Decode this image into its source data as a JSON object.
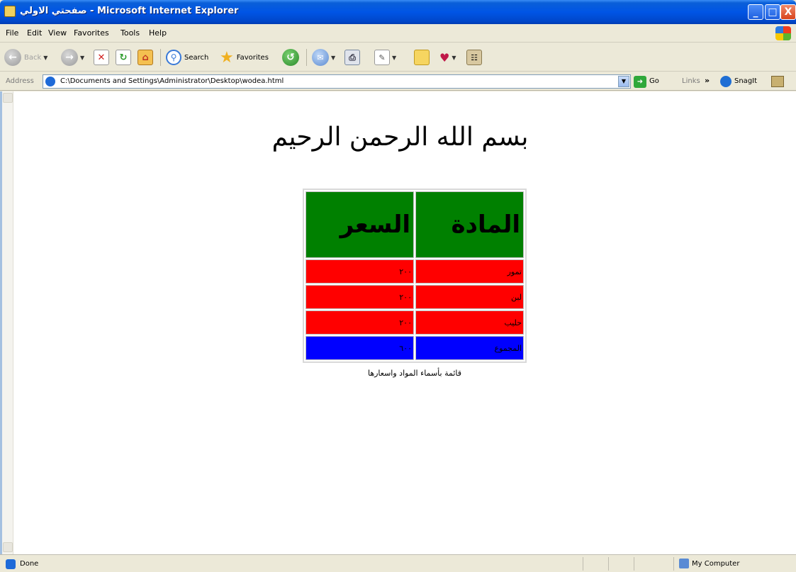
{
  "window": {
    "title": "صفحتي الاولي - Microsoft Internet Explorer",
    "minimize_glyph": "_",
    "maximize_glyph": "□",
    "close_glyph": "X"
  },
  "menu": [
    "File",
    "Edit",
    "View",
    "Favorites",
    "Tools",
    "Help"
  ],
  "toolbar": {
    "back": "Back",
    "search": "Search",
    "favorites": "Favorites"
  },
  "address_bar": {
    "label": "Address",
    "value": "C:\\Documents and Settings\\Administrator\\Desktop\\wodea.html",
    "go_label": "Go",
    "links_label": "Links",
    "snagit_label": "SnagIt"
  },
  "page": {
    "heading": "بسم الله الرحمن الرحيم",
    "table": {
      "headers": [
        "المادة",
        "السعر"
      ],
      "rows": [
        {
          "item": "تمور",
          "price": "٢٠٠",
          "color": "#ff0000"
        },
        {
          "item": "لبن",
          "price": "٢٠٠",
          "color": "#ff0000"
        },
        {
          "item": "حليب",
          "price": "٢٠٠",
          "color": "#ff0000"
        },
        {
          "item": "المجموع",
          "price": "٦٠٠",
          "color": "#0000ff"
        }
      ],
      "header_color": "#008000"
    },
    "caption": "قائمة بأسماء المواد واسعارها"
  },
  "status_bar": {
    "text": "Done",
    "zone": "My Computer"
  }
}
